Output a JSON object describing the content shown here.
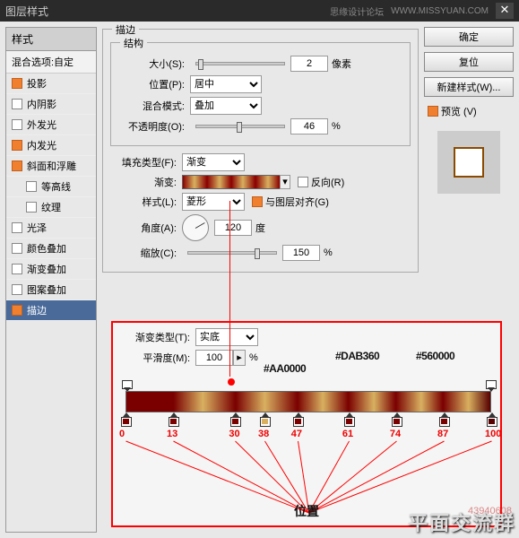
{
  "titlebar": {
    "title": "图层样式",
    "forum": "思缘设计论坛",
    "url": "WWW.MISSYUAN.COM"
  },
  "left": {
    "header": "样式",
    "blend": "混合选项:自定",
    "items": [
      {
        "label": "投影",
        "on": true
      },
      {
        "label": "内阴影",
        "on": false
      },
      {
        "label": "外发光",
        "on": false
      },
      {
        "label": "内发光",
        "on": true
      },
      {
        "label": "斜面和浮雕",
        "on": true
      },
      {
        "label": "等高线",
        "on": false,
        "indent": true
      },
      {
        "label": "纹理",
        "on": false,
        "indent": true
      },
      {
        "label": "光泽",
        "on": false
      },
      {
        "label": "颜色叠加",
        "on": false
      },
      {
        "label": "渐变叠加",
        "on": false
      },
      {
        "label": "图案叠加",
        "on": false
      },
      {
        "label": "描边",
        "on": true,
        "selected": true
      }
    ]
  },
  "stroke": {
    "group": "描边",
    "struct": "结构",
    "size_l": "大小(S):",
    "size_v": "2",
    "size_u": "像素",
    "pos_l": "位置(P):",
    "pos_v": "居中",
    "blend_l": "混合模式:",
    "blend_v": "叠加",
    "opac_l": "不透明度(O):",
    "opac_v": "46",
    "opac_u": "%",
    "fill_l": "填充类型(F):",
    "fill_v": "渐变",
    "grad_l": "渐变:",
    "reverse_l": "反向(R)",
    "style_l": "样式(L):",
    "style_v": "菱形",
    "align_l": "与图层对齐(G)",
    "angle_l": "角度(A):",
    "angle_v": "120",
    "angle_u": "度",
    "scale_l": "缩放(C):",
    "scale_v": "150",
    "scale_u": "%"
  },
  "right": {
    "ok": "确定",
    "cancel": "复位",
    "new": "新建样式(W)...",
    "preview": "预览 (V)"
  },
  "grad_editor": {
    "type_l": "渐变类型(T):",
    "type_v": "实底",
    "smooth_l": "平滑度(M):",
    "smooth_v": "100",
    "smooth_u": "%",
    "hex1": "#AA0000",
    "hex2": "#DAB360",
    "hex3": "#560000",
    "stops": [
      {
        "pos": 0,
        "c": "#7a0000"
      },
      {
        "pos": 13,
        "c": "#7a0000"
      },
      {
        "pos": 30,
        "c": "#7a0000"
      },
      {
        "pos": 38,
        "c": "#d8b060"
      },
      {
        "pos": 47,
        "c": "#7a0000"
      },
      {
        "pos": 61,
        "c": "#7a0000"
      },
      {
        "pos": 74,
        "c": "#7a0000"
      },
      {
        "pos": 87,
        "c": "#7a0000"
      },
      {
        "pos": 100,
        "c": "#560000"
      }
    ],
    "pos_label": "位置"
  },
  "watermark": {
    "id": "43940608",
    "group": "平面交流群"
  }
}
